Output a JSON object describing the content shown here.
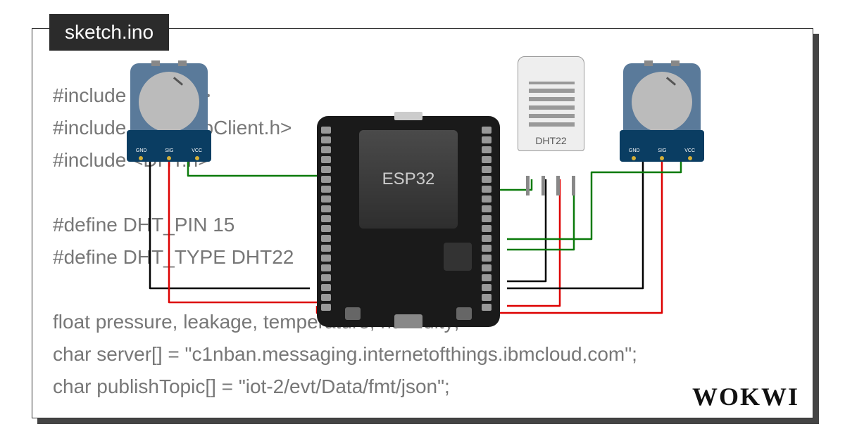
{
  "tab": {
    "filename": "sketch.ino"
  },
  "logo": "WOKWI",
  "code": {
    "line1": "#include <WiFi.h>",
    "line2": "#include <PubSubClient.h>",
    "line3": "#include <DHT.h>",
    "line4": "",
    "line5": "#define DHT_PIN 15",
    "line6": "#define DHT_TYPE DHT22",
    "line7": "",
    "line8": "float pressure, leakage, temperature, humidity;",
    "line9": "char server[] = \"c1nban.messaging.internetofthings.ibmcloud.com\";",
    "line10": "char publishTopic[] = \"iot-2/evt/Data/fmt/json\";"
  },
  "components": {
    "esp32": {
      "label": "ESP32"
    },
    "dht22": {
      "label": "DHT22"
    },
    "pot": {
      "pins": [
        "GND",
        "SIG",
        "VCC"
      ]
    }
  }
}
